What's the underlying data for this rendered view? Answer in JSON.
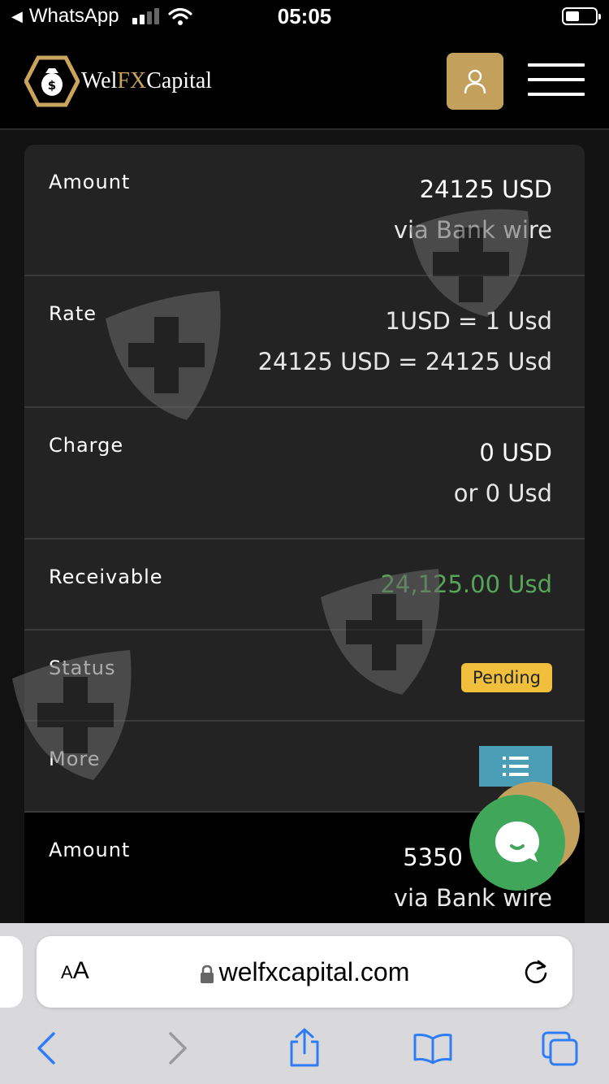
{
  "status_bar": {
    "back_app": "WhatsApp",
    "time": "05:05"
  },
  "header": {
    "logo_part1": "Wel",
    "logo_part2": "FX",
    "logo_part3": "Capital"
  },
  "rows": [
    {
      "label": "Amount",
      "value": "24125 USD",
      "sub": "via Bank wire"
    },
    {
      "label": "Rate",
      "value": "1USD = 1 Usd",
      "sub": "24125 USD = 24125 Usd"
    },
    {
      "label": "Charge",
      "value": "0 USD",
      "sub": "or 0 Usd"
    },
    {
      "label": "Receivable",
      "value": "24,125.00 Usd"
    },
    {
      "label": "Status",
      "badge": "Pending"
    },
    {
      "label": "More"
    },
    {
      "label": "Amount",
      "value": "5350",
      "sub": "via Bank wire"
    }
  ],
  "browser": {
    "aa_small": "A",
    "aa_big": "A",
    "url": "welfxcapital.com"
  },
  "colors": {
    "gold": "#c3a15c",
    "receivable_green": "#57a55a",
    "pending_yellow": "#f0c03c",
    "more_teal": "#4a9fb6",
    "chat_green": "#3fa65a",
    "safari_blue": "#2f7df6"
  },
  "icons": {
    "user": "user-icon",
    "menu": "hamburger-icon",
    "list": "list-icon",
    "chat": "chat-bubble-icon",
    "lock": "lock-icon",
    "reload": "reload-icon",
    "back": "chevron-left-icon",
    "forward": "chevron-right-icon",
    "share": "share-icon",
    "bookmarks": "book-icon",
    "tabs": "tabs-icon"
  }
}
